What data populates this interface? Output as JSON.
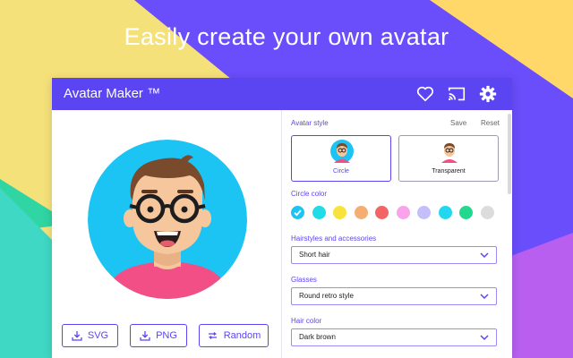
{
  "headline": "Easily create your own avatar",
  "app": {
    "title": "Avatar Maker ™",
    "icons": [
      "heart-icon",
      "cast-icon",
      "gear-icon"
    ]
  },
  "download_buttons": [
    {
      "label": "SVG",
      "icon": "download-icon"
    },
    {
      "label": "PNG",
      "icon": "download-icon"
    },
    {
      "label": "Random",
      "icon": "shuffle-icon"
    }
  ],
  "panel": {
    "avatar_style_label": "Avatar style",
    "save_label": "Save",
    "reset_label": "Reset",
    "styles": [
      {
        "label": "Circle",
        "selected": true
      },
      {
        "label": "Transparent",
        "selected": false
      }
    ],
    "circle_color_label": "Circle color",
    "circle_colors": [
      "#1ec8ef",
      "#20dbe8",
      "#f7e33b",
      "#f4ae73",
      "#f56464",
      "#f8a3ea",
      "#c4bff9",
      "#24d7f0",
      "#22d88f",
      "#dcdcdc"
    ],
    "selected_color_index": 0,
    "hairstyles_label": "Hairstyles and accessories",
    "hairstyle_value": "Short hair",
    "glasses_label": "Glasses",
    "glasses_value": "Round retro style",
    "hair_color_label": "Hair color",
    "hair_color_value": "Dark brown"
  },
  "colors": {
    "accent": "#5b45f2",
    "avatar_bg": "#1cc4f4",
    "shirt": "#f24f86",
    "skin": "#f6c79d",
    "hair": "#7a4a2c"
  }
}
